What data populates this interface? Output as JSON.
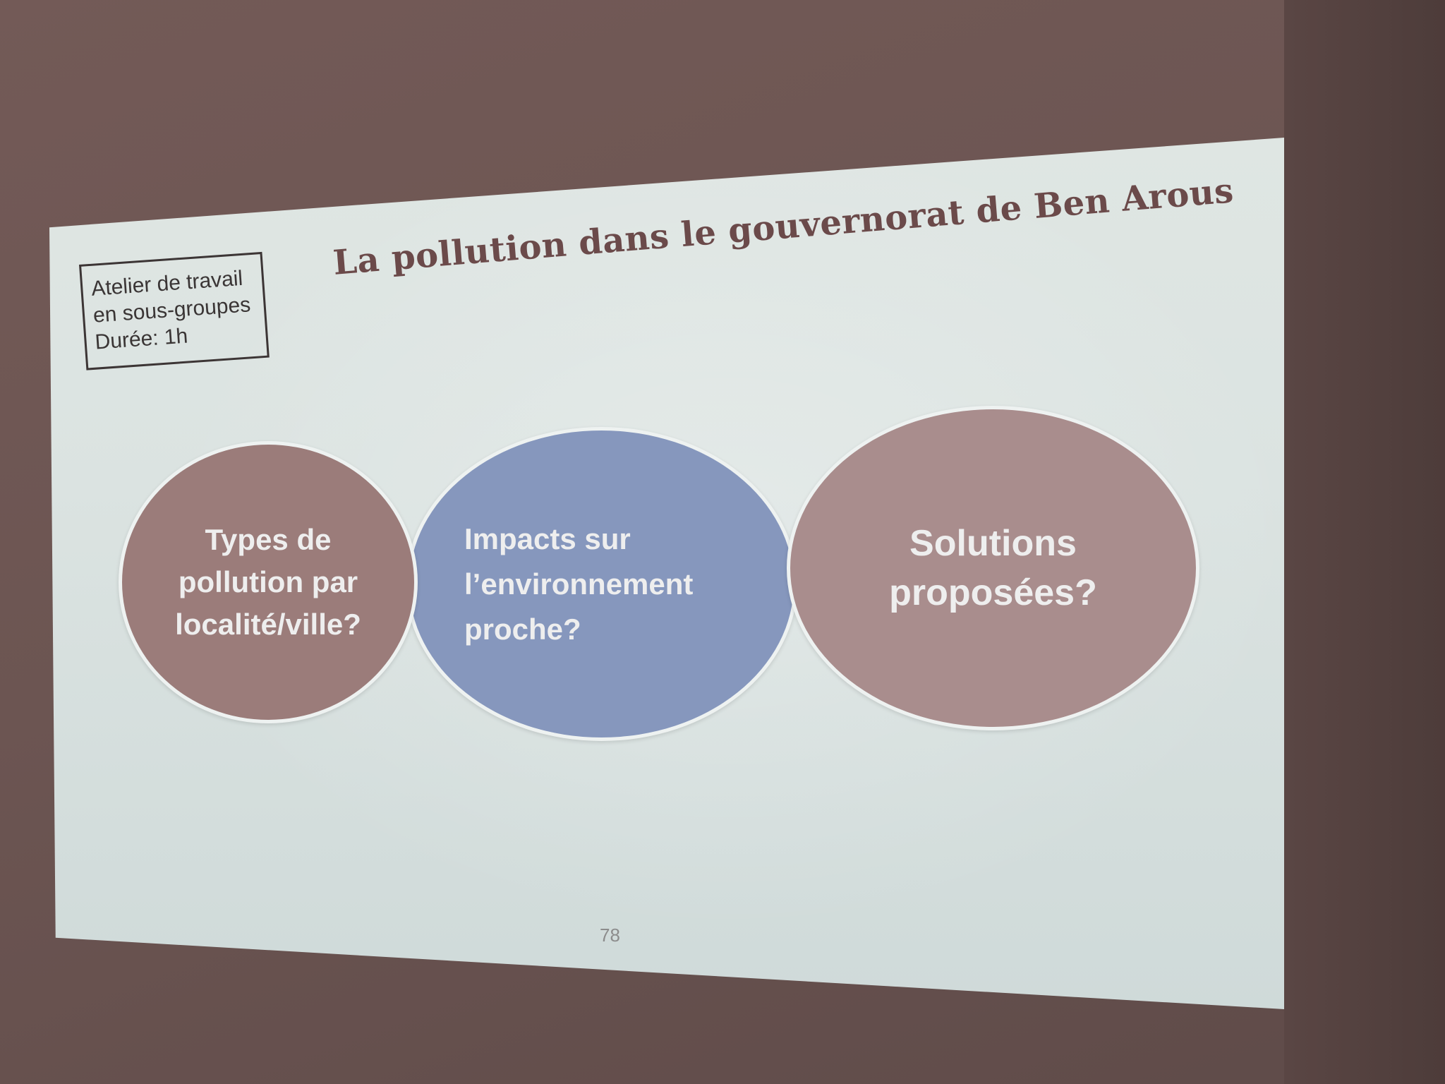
{
  "slide": {
    "workshop_box": {
      "line1": "Atelier de travail",
      "line2": "en sous-groupes",
      "line3": "Durée: 1h"
    },
    "title": "La pollution dans le gouvernorat de Ben Arous",
    "ovals": [
      {
        "lines": [
          "Types de",
          "pollution par",
          "localité/ville?"
        ],
        "color": "#9b7c7a"
      },
      {
        "lines": [
          "Impacts sur",
          "l’environnement",
          "proche?"
        ],
        "color": "#8697bd"
      },
      {
        "lines": [
          "Solutions",
          "proposées?"
        ],
        "color": "#a98d8d"
      }
    ],
    "page_number": "78"
  }
}
